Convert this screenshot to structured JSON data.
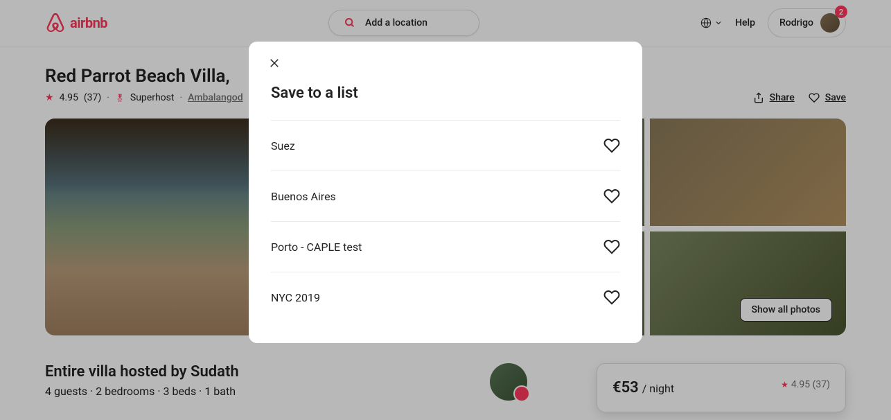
{
  "header": {
    "brand": "airbnb",
    "search_placeholder": "Add a location",
    "help": "Help",
    "user_name": "Rodrigo",
    "notifications": "2"
  },
  "listing": {
    "title": "Red Parrot Beach Villa,",
    "rating": "4.95",
    "reviews": "(37)",
    "superhost": "Superhost",
    "location": "Ambalangod",
    "share": "Share",
    "save": "Save",
    "show_photos": "Show all photos",
    "host_title": "Entire villa hosted by Sudath",
    "host_details": "4 guests · 2 bedrooms · 3 beds · 1 bath",
    "price": "€53",
    "price_unit": "/ night",
    "card_rating": "4.95 (37)"
  },
  "modal": {
    "title": "Save to a list",
    "lists": [
      {
        "name": "Suez"
      },
      {
        "name": "Buenos Aires"
      },
      {
        "name": "Porto - CAPLE test"
      },
      {
        "name": "NYC 2019"
      }
    ]
  }
}
